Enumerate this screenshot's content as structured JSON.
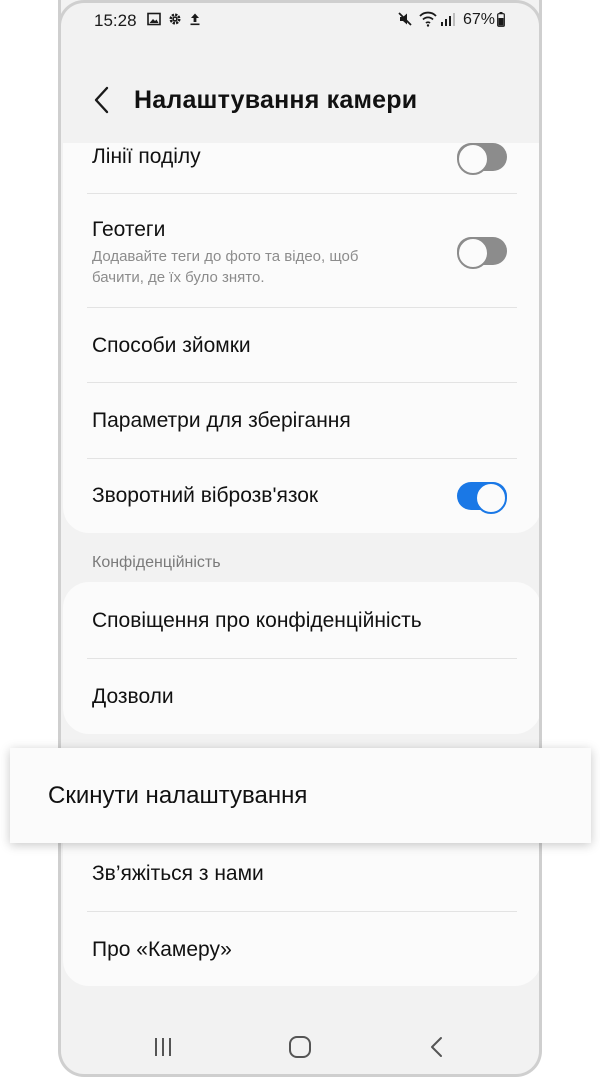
{
  "status_bar": {
    "time": "15:28",
    "battery": "67%"
  },
  "header": {
    "title": "Налаштування камери"
  },
  "settings_card": {
    "grid_lines": {
      "label": "Лінії поділу",
      "enabled": false
    },
    "geotags": {
      "label": "Геотеги",
      "description": "Додавайте теги до фото та відео, щоб бачити, де їх було знято.",
      "enabled": false
    },
    "shooting_methods": {
      "label": "Способи зйомки"
    },
    "storage_options": {
      "label": "Параметри для зберігання"
    },
    "vibration_feedback": {
      "label": "Зворотний віброзв'язок",
      "enabled": true
    }
  },
  "privacy_section": {
    "label": "Конфіденційність",
    "privacy_notice": {
      "label": "Сповіщення про конфіденційність"
    },
    "permissions": {
      "label": "Дозволи"
    }
  },
  "reset_callout": {
    "label": "Скинути налаштування"
  },
  "about_card": {
    "contact_us": {
      "label": "Зв’яжіться з нами"
    },
    "about_camera": {
      "label": "Про «Камеру»"
    }
  },
  "colors": {
    "accent": "#1a78e6",
    "toggle_off": "#8c8c8c",
    "background": "#f2f2f2",
    "card": "#fbfbfb"
  },
  "icons": [
    "gallery-icon",
    "gear-icon",
    "upload-icon",
    "mute-icon",
    "wifi-icon",
    "signal-icon",
    "battery-icon",
    "back-arrow-icon",
    "recents-icon",
    "home-icon",
    "nav-back-icon"
  ]
}
